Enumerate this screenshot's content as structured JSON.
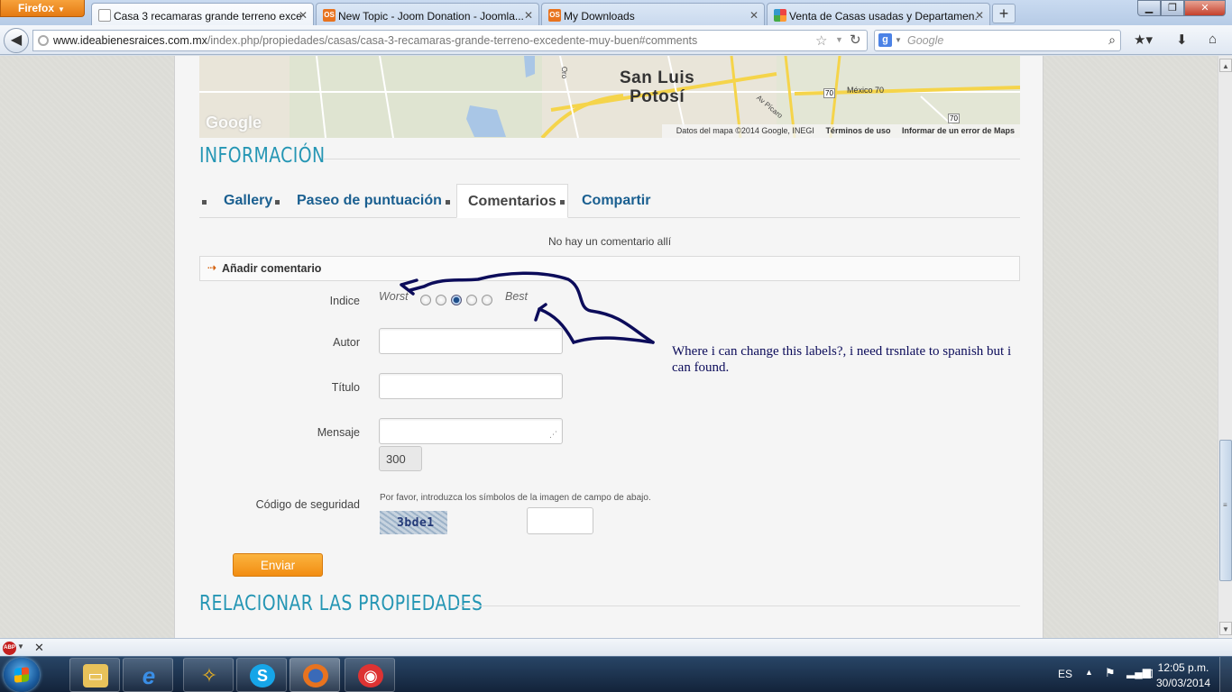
{
  "browser": {
    "menu_label": "Firefox",
    "tabs": [
      {
        "title": "Casa 3 recamaras grande terreno exce...",
        "active": true,
        "icon": "page-icon"
      },
      {
        "title": "New Topic - Joom Donation - Joomla...",
        "active": false,
        "icon": "os-icon"
      },
      {
        "title": "My Downloads",
        "active": false,
        "icon": "os-icon"
      },
      {
        "title": "Venta de Casas usadas y Departamen...",
        "active": false,
        "icon": "joomla-icon"
      }
    ],
    "new_tab_label": "+",
    "url_host": "www.ideabienesraices.com.mx",
    "url_path": "/index.php/propiedades/casas/casa-3-recamaras-grande-terreno-excedente-muy-buen#comments",
    "search_placeholder": "Google",
    "search_engine_icon": "g"
  },
  "map": {
    "city_line1": "San Luis",
    "city_line2": "Potosí",
    "watermark": "Google",
    "footer_data": "Datos del mapa ©2014 Google, INEGI",
    "footer_terms": "Términos de uso",
    "footer_report": "Informar de un error de Maps",
    "road_labels": {
      "r70a": "70",
      "r70b": "70",
      "mexico70": "México 70",
      "r70c": "70",
      "av": "Av Pícaro",
      "oro": "Oro"
    }
  },
  "page": {
    "info_heading": "INFORMACIÓN",
    "tabs": [
      {
        "label": "Gallery",
        "active": false
      },
      {
        "label": "Paseo de puntuación",
        "active": false
      },
      {
        "label": "Comentarios",
        "active": true
      },
      {
        "label": "Compartir",
        "active": false
      }
    ],
    "no_comments": "No hay un comentario allí",
    "add_comment": "Añadir comentario",
    "form": {
      "rating_label": "Indice",
      "rating_worst": "Worst",
      "rating_best": "Best",
      "rating_options": 5,
      "rating_selected": 3,
      "author_label": "Autor",
      "title_label": "Título",
      "message_label": "Mensaje",
      "char_counter": "300",
      "security_label": "Código de seguridad",
      "captcha_hint": "Por favor, introduzca los símbolos de la imagen de campo de abajo.",
      "captcha_text": "3bde1",
      "submit_label": "Enviar"
    },
    "related_heading": "RELACIONAR LAS PROPIEDADES"
  },
  "annotation": {
    "text": "Where i can change this labels?, i need trsnlate to spanish but i can found.",
    "color": "#0c0c5a"
  },
  "taskbar": {
    "apps": [
      "explorer",
      "internet-explorer",
      "tools",
      "skype",
      "firefox",
      "screenshot"
    ],
    "language": "ES",
    "time": "12:05 p.m.",
    "date": "30/03/2014"
  },
  "colors": {
    "heading": "#2596b4",
    "tab_link": "#1a5f90",
    "submit": "#f28d12",
    "ff_menu": "#e57a12"
  }
}
